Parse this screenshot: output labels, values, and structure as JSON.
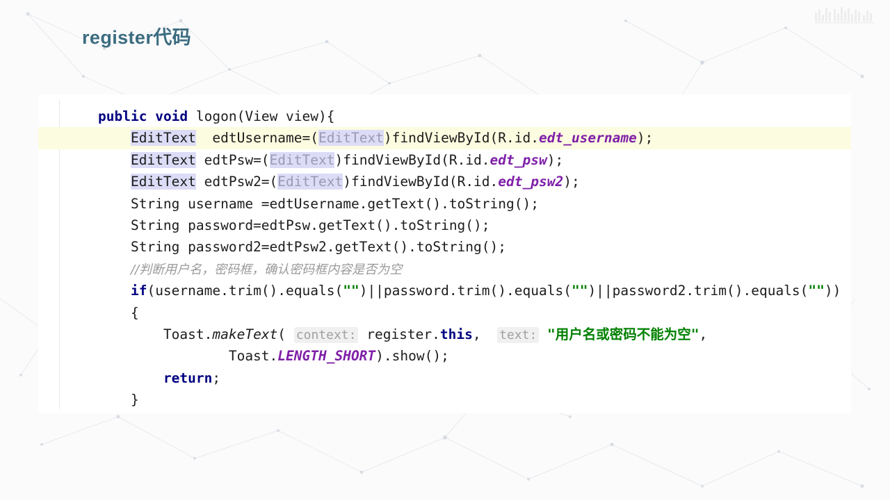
{
  "slide": {
    "title": "register代码",
    "title_color": "#3c6c80",
    "background_color": "#fbfbfc"
  },
  "watermark": {
    "name": "bar-logo-watermark"
  },
  "editor": {
    "panel_background": "#ffffff",
    "current_line_highlight": "#fcfce0",
    "occurrence_highlight": "#dcdcf7",
    "gutter": {
      "bulb_icon": "lightbulb-icon",
      "bulb_color": "#f2b705"
    },
    "colors": {
      "keyword": "#000080",
      "string": "#008000",
      "static_field": "#7f1fa8",
      "comment": "#9a9a9a",
      "cast_type": "#9a9ab4",
      "param_hint": "#a0a0a0",
      "default_text": "#1c1c1c"
    },
    "param_hints": {
      "context": "context:",
      "text": "text:"
    },
    "code_lines": [
      {
        "id": "line-1",
        "current": false,
        "text": "public void logon(View view){"
      },
      {
        "id": "line-2",
        "current": true,
        "text": "    EditText  edtUsername=(EditText)findViewById(R.id.edt_username);"
      },
      {
        "id": "line-3",
        "current": false,
        "text": "    EditText edtPsw=(EditText)findViewById(R.id.edt_psw);"
      },
      {
        "id": "line-4",
        "current": false,
        "text": "    EditText edtPsw2=(EditText)findViewById(R.id.edt_psw2);"
      },
      {
        "id": "line-5",
        "current": false,
        "text": "    String username =edtUsername.getText().toString();"
      },
      {
        "id": "line-6",
        "current": false,
        "text": "    String password=edtPsw.getText().toString();"
      },
      {
        "id": "line-7",
        "current": false,
        "text": "    String password2=edtPsw2.getText().toString();"
      },
      {
        "id": "line-8",
        "current": false,
        "text": "    //判断用户名，密码框，确认密码框内容是否为空"
      },
      {
        "id": "line-9",
        "current": false,
        "text": "    if(username.trim().equals(\"\")||password.trim().equals(\"\")||password2.trim().equals(\"\"))"
      },
      {
        "id": "line-10",
        "current": false,
        "text": "    {"
      },
      {
        "id": "line-11",
        "current": false,
        "text": "        Toast.makeText( context: register.this,  text: \"用户名或密码不能为空\","
      },
      {
        "id": "line-12",
        "current": false,
        "text": "                Toast.LENGTH_SHORT).show();"
      },
      {
        "id": "line-13",
        "current": false,
        "text": "        return;"
      },
      {
        "id": "line-14",
        "current": false,
        "text": "    }"
      }
    ]
  }
}
